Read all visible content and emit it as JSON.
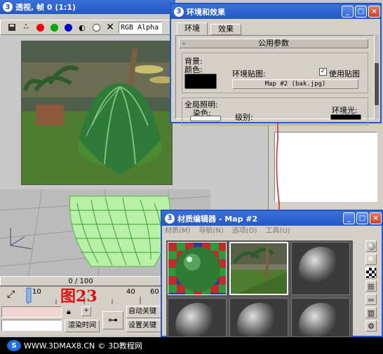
{
  "viewport": {
    "title": "透视, 帧 0 (1:1)",
    "channel": "RGB Alpha",
    "frame_counter": "0 / 100"
  },
  "env_dialog": {
    "title": "环境和效果",
    "tabs": [
      "环境",
      "效果"
    ],
    "rollout_minus": "-",
    "rollout": "公用参数",
    "background_group": "背景:",
    "color_label": "颜色:",
    "env_map_label": "环境贴图:",
    "use_map_label": "使用贴图",
    "use_map_checked": true,
    "map_button": "Map #2 (bak.jpg)",
    "global_lighting_group": "全局照明:",
    "tint_label": "染色:",
    "level_label": "级别:",
    "ambient_label": "环境光:"
  },
  "material_editor": {
    "title": "材质编辑器 - Map #2",
    "menu": [
      "材质",
      "导航",
      "选项",
      "工具"
    ]
  },
  "timeline": {
    "ticks": [
      "10",
      "40",
      "60"
    ]
  },
  "bottom_controls": {
    "render_time": "渲染时间",
    "auto_key": "自动关键",
    "set_key": "设置关键"
  },
  "annotation": "图23",
  "watermark": {
    "site": "WWW.3DMAX8.CN",
    "name": "3D教程网"
  },
  "colors": {
    "titlebar": "#2458c4",
    "annotation": "#e01010",
    "map_link_line": "#e02020"
  },
  "window_buttons": {
    "minimize": "_",
    "maximize": "□",
    "close": "×"
  }
}
